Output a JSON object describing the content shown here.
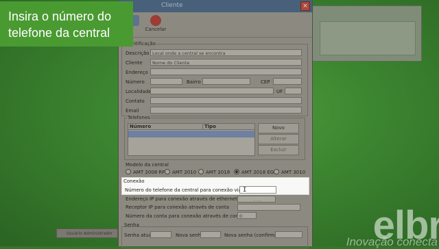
{
  "banner": {
    "line1": "Insira o número do",
    "line2": "telefone da central"
  },
  "background": {
    "brand": "elbr",
    "tagline": "Inovação conecta"
  },
  "window": {
    "title": "Cliente",
    "close": "×"
  },
  "toolbar": {
    "save_label": "",
    "cancel_label": "Cancelar"
  },
  "ident": {
    "title": "Identificação",
    "labels": {
      "descricao": "Descrição",
      "cliente": "Cliente",
      "endereco": "Endereço",
      "numero": "Número",
      "bairro": "Bairro",
      "cep": "CEP",
      "localidade": "Localidade",
      "uf": "UF",
      "contato": "Contato",
      "email": "Email"
    },
    "values": {
      "descricao": "Local onde a central se encontra",
      "cliente": "Nome do Cliente"
    }
  },
  "phones": {
    "title": "Telefones",
    "columns": [
      "Número",
      "Tipo"
    ],
    "buttons": {
      "novo": "Novo",
      "alterar": "Alterar",
      "excluir": "Excluir"
    }
  },
  "model": {
    "title": "Modelo da central",
    "options": [
      "AMT 2008 RF",
      "AMT 2010",
      "AMT 2018",
      "AMT 2018 EG",
      "AMT 3010"
    ],
    "selected": "AMT 2018 EG"
  },
  "connection": {
    "title": "Conexão",
    "phone_label": "Número do telefone da central para conexão via modem",
    "phone_value": "",
    "ip_label": "Endereço IP para conexão através de ethernet",
    "ip_value": ". . .",
    "receiver_label": "Receptor IP para conexão através de conta",
    "account_label": "Número da conta para conexão através de conta",
    "account_value": "0"
  },
  "password": {
    "title": "Senha",
    "current_label": "Senha atual",
    "new_label": "Nova senha",
    "confirm_label": "Nova senha (confirmação)"
  },
  "status": {
    "user": "Usuário Administrador"
  },
  "colors": {
    "banner": "#4a9a32",
    "background": "#3c8530",
    "highlight": "#f8f8f6"
  }
}
